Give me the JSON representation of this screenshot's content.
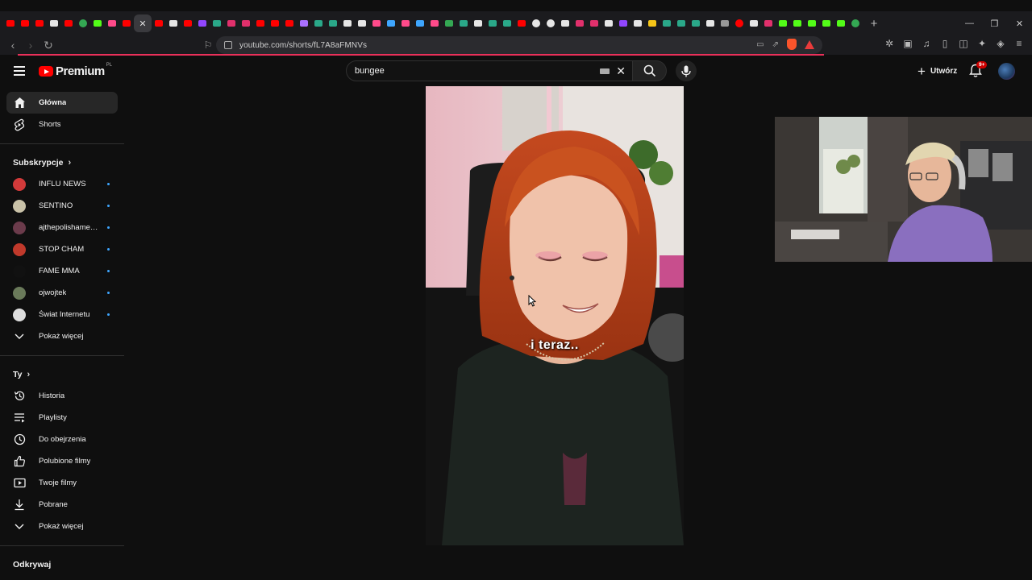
{
  "browser": {
    "url": "youtube.com/shorts/fL7A8aFMNVs",
    "tabs": [
      {
        "color": "#ff0000"
      },
      {
        "color": "#ff0000"
      },
      {
        "color": "#ff0000"
      },
      {
        "color": "#e6e6e6"
      },
      {
        "color": "#ff0000"
      },
      {
        "color": "#34a853",
        "round": true
      },
      {
        "color": "#53fc18"
      },
      {
        "color": "#ff4a8a"
      },
      {
        "color": "#ff0000"
      },
      {
        "color": "active"
      },
      {
        "color": "#ff0000"
      },
      {
        "color": "#e6e6e6"
      },
      {
        "color": "#ff0000"
      },
      {
        "color": "#9146ff"
      },
      {
        "color": "#2aa889"
      },
      {
        "color": "#e1306c"
      },
      {
        "color": "#e1306c"
      },
      {
        "color": "#ff0000"
      },
      {
        "color": "#ff0000"
      },
      {
        "color": "#ff0000"
      },
      {
        "color": "#a970ff"
      },
      {
        "color": "#2aa889"
      },
      {
        "color": "#2aa889"
      },
      {
        "color": "#e6e6e6"
      },
      {
        "color": "#e6e6e6"
      },
      {
        "color": "#ff4a8a"
      },
      {
        "color": "#3ea6ff"
      },
      {
        "color": "#ff4a8a"
      },
      {
        "color": "#3ea6ff"
      },
      {
        "color": "#ff4a8a"
      },
      {
        "color": "#34a853"
      },
      {
        "color": "#2aa889"
      },
      {
        "color": "#e6e6e6"
      },
      {
        "color": "#2aa889"
      },
      {
        "color": "#2aa889"
      },
      {
        "color": "#ff0000"
      },
      {
        "color": "#e6e6e6",
        "round": true
      },
      {
        "color": "#e6e6e6",
        "round": true
      },
      {
        "color": "#e6e6e6"
      },
      {
        "color": "#e1306c"
      },
      {
        "color": "#e1306c"
      },
      {
        "color": "#e6e6e6"
      },
      {
        "color": "#9146ff"
      },
      {
        "color": "#e6e6e6"
      },
      {
        "color": "#f5c518"
      },
      {
        "color": "#2aa889"
      },
      {
        "color": "#2aa889"
      },
      {
        "color": "#2aa889"
      },
      {
        "color": "#e6e6e6"
      },
      {
        "color": "#999999"
      },
      {
        "color": "#ff0000",
        "round": true
      },
      {
        "color": "#e6e6e6"
      },
      {
        "color": "#e1306c"
      },
      {
        "color": "#53fc18"
      },
      {
        "color": "#53fc18"
      },
      {
        "color": "#53fc18"
      },
      {
        "color": "#53fc18"
      },
      {
        "color": "#53fc18"
      },
      {
        "color": "#34a853",
        "round": true
      }
    ],
    "active_tab_close": "✕",
    "new_tab": "+",
    "window_controls": [
      "—",
      "❐",
      "✕"
    ]
  },
  "masthead": {
    "brand": "Premium",
    "country_code": "PL",
    "search_value": "bungee",
    "create_label": "Utwórz",
    "notifications_badge": "9+"
  },
  "sidebar": {
    "main": [
      {
        "label": "Główna",
        "icon": "home-icon",
        "active": true
      },
      {
        "label": "Shorts",
        "icon": "shorts-icon"
      }
    ],
    "subscriptions_title": "Subskrypcje",
    "subscriptions": [
      {
        "label": "INFLU NEWS",
        "avatar_color": "#d23a3a",
        "new": true
      },
      {
        "label": "SENTINO",
        "avatar_color": "#c9c2a8",
        "new": true
      },
      {
        "label": "ajthepolishameri...",
        "avatar_color": "#6b3b4b",
        "new": true
      },
      {
        "label": "STOP CHAM",
        "avatar_color": "#c0392b",
        "new": true
      },
      {
        "label": "FAME MMA",
        "avatar_color": "#111111",
        "new": true
      },
      {
        "label": "ojwojtek",
        "avatar_color": "#6a7a5a",
        "new": true
      },
      {
        "label": "Świat Internetu",
        "avatar_color": "#dddddd",
        "new": true
      }
    ],
    "show_more": "Pokaż więcej",
    "you_title": "Ty",
    "you": [
      {
        "label": "Historia",
        "icon": "history-icon"
      },
      {
        "label": "Playlisty",
        "icon": "playlists-icon"
      },
      {
        "label": "Do obejrzenia",
        "icon": "watch-later-icon"
      },
      {
        "label": "Polubione filmy",
        "icon": "thumbs-up-icon"
      },
      {
        "label": "Twoje filmy",
        "icon": "your-videos-icon"
      },
      {
        "label": "Pobrane",
        "icon": "download-icon"
      }
    ],
    "you_show_more": "Pokaż więcej",
    "explore_title": "Odkrywaj"
  },
  "player": {
    "caption": "i teraz.."
  }
}
